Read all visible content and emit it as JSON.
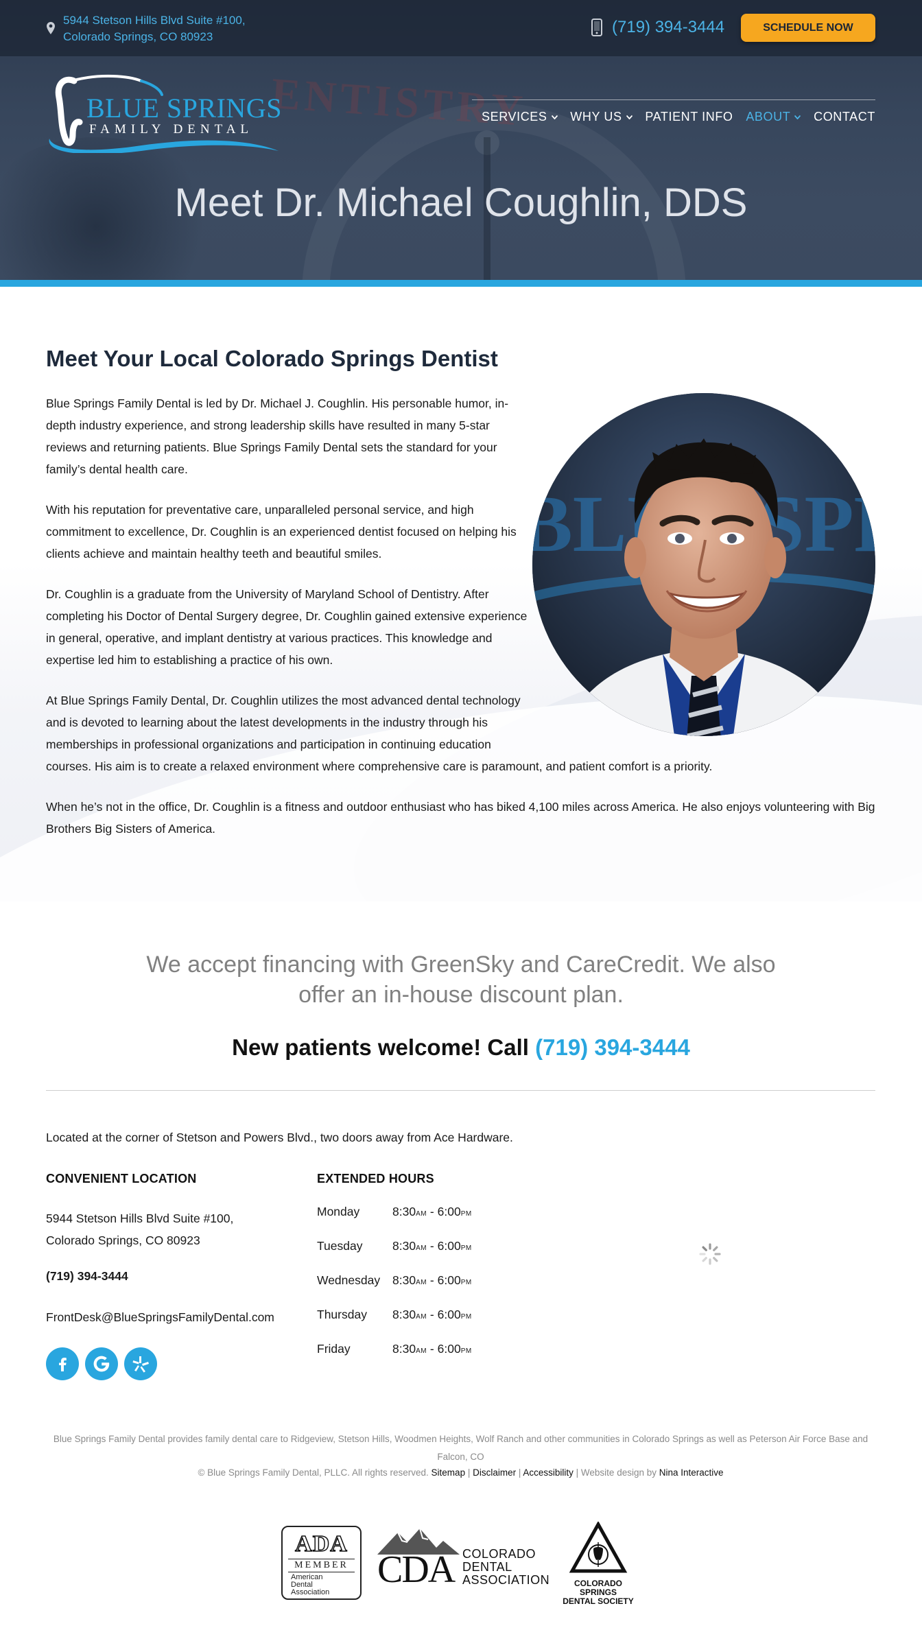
{
  "topbar": {
    "address_line1": "5944 Stetson Hills Blvd Suite #100,",
    "address_line2": "Colorado Springs, CO 80923",
    "phone": "(719) 394-3444",
    "schedule_label": "SCHEDULE NOW"
  },
  "logo": {
    "line1": "BLUE SPRINGS",
    "line2": "FAMILY DENTAL"
  },
  "nav": {
    "items": [
      {
        "label": "SERVICES",
        "dropdown": true,
        "active": false
      },
      {
        "label": "WHY US",
        "dropdown": true,
        "active": false
      },
      {
        "label": "PATIENT INFO",
        "dropdown": false,
        "active": false
      },
      {
        "label": "ABOUT",
        "dropdown": true,
        "active": true
      },
      {
        "label": "CONTACT",
        "dropdown": false,
        "active": false
      }
    ]
  },
  "hero": {
    "title": "Meet Dr. Michael Coughlin, DDS",
    "background_text": "ENTISTRY"
  },
  "main": {
    "heading": "Meet Your Local Colorado Springs Dentist",
    "paragraphs": [
      [
        "Blue Springs Family Dental is led by Dr. Michael J. Coughlin. His personable humor, in-",
        "depth industry experience, and strong leadership skills have resulted in many 5-star",
        "reviews and returning patients. Blue Springs Family Dental sets the standard for your",
        "family’s dental health care."
      ],
      [
        "With his reputation for preventative care, unparalleled personal service, and high",
        "commitment to excellence, Dr. Coughlin is an experienced dentist focused on helping his",
        "clients achieve and maintain healthy teeth and beautiful smiles."
      ],
      [
        "Dr. Coughlin is a graduate from the University of Maryland School of Dentistry. After",
        "completing his Doctor of Dental Surgery degree, Dr. Coughlin gained extensive experience",
        "in general, operative, and implant dentistry at various practices. This knowledge and",
        "expertise led him to establishing a practice of his own."
      ],
      [
        "At Blue Springs Family Dental, Dr. Coughlin utilizes the most advanced dental technology",
        "and is devoted to learning about the latest developments in the industry through his",
        "memberships in professional organizations and participation in continuing education",
        "courses. His aim is to create a relaxed environment where comprehensive care is paramount, and patient comfort is a priority."
      ],
      [
        "When he’s not in the office, Dr. Coughlin is a fitness and outdoor enthusiast who has biked 4,100 miles across America. He also enjoys volunteering with Big",
        "Brothers Big Sisters of America."
      ]
    ],
    "portrait_bg_text": "BLUE SPRINGS"
  },
  "financing": {
    "line1": "We accept financing with GreenSky and CareCredit. We also",
    "line2": "offer an in-house discount plan.",
    "newpat_text": "New patients welcome! Call ",
    "newpat_phone": "(719) 394-3444"
  },
  "contact": {
    "located": "Located at the corner of Stetson and Powers Blvd., two doors away from Ace Hardware.",
    "location_heading": "CONVENIENT LOCATION",
    "address_line1": "5944 Stetson Hills Blvd Suite #100,",
    "address_line2": "Colorado Springs, CO 80923",
    "phone": "(719) 394-3444",
    "email": "FrontDesk@BlueSpringsFamilyDental.com",
    "hours_heading": "EXTENDED HOURS",
    "hours": [
      {
        "day": "Monday",
        "open": "8:30",
        "open_ampm": "AM",
        "close": "6:00",
        "close_ampm": "PM"
      },
      {
        "day": "Tuesday",
        "open": "8:30",
        "open_ampm": "AM",
        "close": "6:00",
        "close_ampm": "PM"
      },
      {
        "day": "Wednesday",
        "open": "8:30",
        "open_ampm": "AM",
        "close": "6:00",
        "close_ampm": "PM"
      },
      {
        "day": "Thursday",
        "open": "8:30",
        "open_ampm": "AM",
        "close": "6:00",
        "close_ampm": "PM"
      },
      {
        "day": "Friday",
        "open": "8:30",
        "open_ampm": "AM",
        "close": "6:00",
        "close_ampm": "PM"
      }
    ],
    "hours_separator": " - ",
    "social_icons": [
      "facebook-icon",
      "google-icon",
      "yelp-icon"
    ]
  },
  "footer": {
    "service_line1": "Blue Springs Family Dental provides family dental care to Ridgeview, Stetson Hills, Woodmen Heights, Wolf Ranch and other communities in Colorado Springs as well as Peterson Air Force Base and",
    "service_line2": "Falcon, CO",
    "copyright": "© Blue Springs Family Dental, PLLC. All rights reserved. ",
    "sitemap": "Sitemap",
    "disclaimer": "Disclaimer",
    "accessibility": "Accessibility",
    "sep": " | ",
    "design_by": "Website design by ",
    "designer": "Nina Interactive"
  },
  "badges": {
    "ada_title": "ADA",
    "ada_member": "MEMBER",
    "ada_sub1": "American",
    "ada_sub2": "Dental",
    "ada_sub3": "Association",
    "cda_letters": "CDA",
    "cda_word1": "COLORADO",
    "cda_word2": "DENTAL",
    "cda_word3": "ASSOCIATION",
    "css_line1": "COLORADO SPRINGS",
    "css_line2": "DENTAL SOCIETY"
  },
  "colors": {
    "accent_blue": "#29a6df",
    "cta_orange": "#f6a71f",
    "navy": "#1e2a3b"
  }
}
